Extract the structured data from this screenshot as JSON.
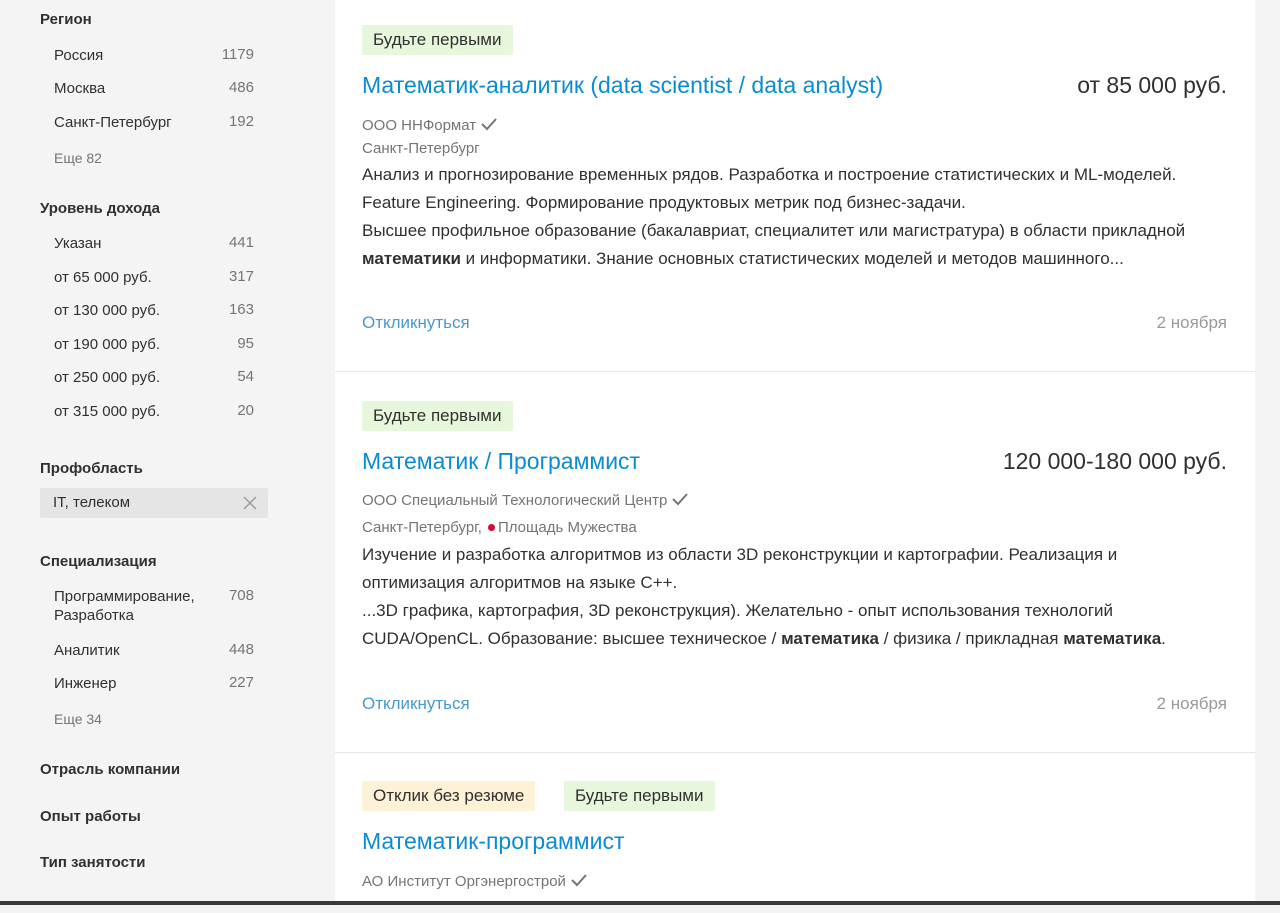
{
  "filters": {
    "region": {
      "title": "Регион",
      "items": [
        {
          "label": "Россия",
          "count": "1179"
        },
        {
          "label": "Москва",
          "count": "486"
        },
        {
          "label": "Санкт-Петербург",
          "count": "192"
        }
      ],
      "more": "Еще 82"
    },
    "income": {
      "title": "Уровень дохода",
      "items": [
        {
          "label": "Указан",
          "count": "441"
        },
        {
          "label": "от 65 000 руб.",
          "count": "317"
        },
        {
          "label": "от 130 000 руб.",
          "count": "163"
        },
        {
          "label": "от 190 000 руб.",
          "count": "95"
        },
        {
          "label": "от 250 000 руб.",
          "count": "54"
        },
        {
          "label": "от 315 000 руб.",
          "count": "20"
        }
      ]
    },
    "profarea": {
      "title": "Профобласть",
      "selected": "IT, телеком"
    },
    "specialization": {
      "title": "Специализация",
      "items": [
        {
          "label": "Программирование, Разработка",
          "count": "708"
        },
        {
          "label": "Аналитик",
          "count": "448"
        },
        {
          "label": "Инженер",
          "count": "227"
        }
      ],
      "more": "Еще 34"
    },
    "industry": {
      "title": "Отрасль компании"
    },
    "experience": {
      "title": "Опыт работы"
    },
    "employment": {
      "title": "Тип занятости"
    }
  },
  "vacancies": [
    {
      "badges": [
        "Будьте первыми"
      ],
      "title": "Математик-аналитик (data scientist / data analyst)",
      "salary": "от 85 000 руб.",
      "company": "ООО ННФормат",
      "location": "Санкт-Петербург",
      "desc1": {
        "t1": "Анализ и прогнозирование временных рядов. Разработка и построение статистических и ML-моделей. Feature Engineering. Формирование продуктовых метрик под бизнес-задачи."
      },
      "desc2": {
        "t1": "Высшее профильное образование (бакалавриат, специалитет или магистратура) в области прикладной ",
        "b1": "математики",
        "t2": " и информатики. Знание основных статистических моделей и методов машинного..."
      },
      "apply": "Откликнуться",
      "date": "2 ноября"
    },
    {
      "badges": [
        "Будьте первыми"
      ],
      "title": "Математик / Программист",
      "salary": "120 000-180 000 руб.",
      "company": "ООО Специальный Технологический Центр",
      "location": "Санкт-Петербург,",
      "metro": "Площадь Мужества",
      "desc1": {
        "t1": "Изучение и разработка алгоритмов из области 3D реконструкции и картографии. Реализация и оптимизация алгоритмов на языке С++."
      },
      "desc2": {
        "t1": "...3D графика, картография, 3D реконструкция). Желательно - опыт использования технологий CUDA/OpenCL. Образование: высшее техническое / ",
        "b1": "математика",
        "t2": " / физика / прикладная ",
        "b2": "математика",
        "t3": "."
      },
      "apply": "Откликнуться",
      "date": "2 ноября"
    },
    {
      "badges": [
        "Отклик без резюме",
        "Будьте первыми"
      ],
      "title": "Математик-программист",
      "company": "АО Институт Оргэнергострой"
    }
  ],
  "colors": {
    "link": "#0a8cd1",
    "badge_green": "#e6f7dc",
    "badge_yellow": "#fdf1d6",
    "metro": "#d6083b"
  }
}
